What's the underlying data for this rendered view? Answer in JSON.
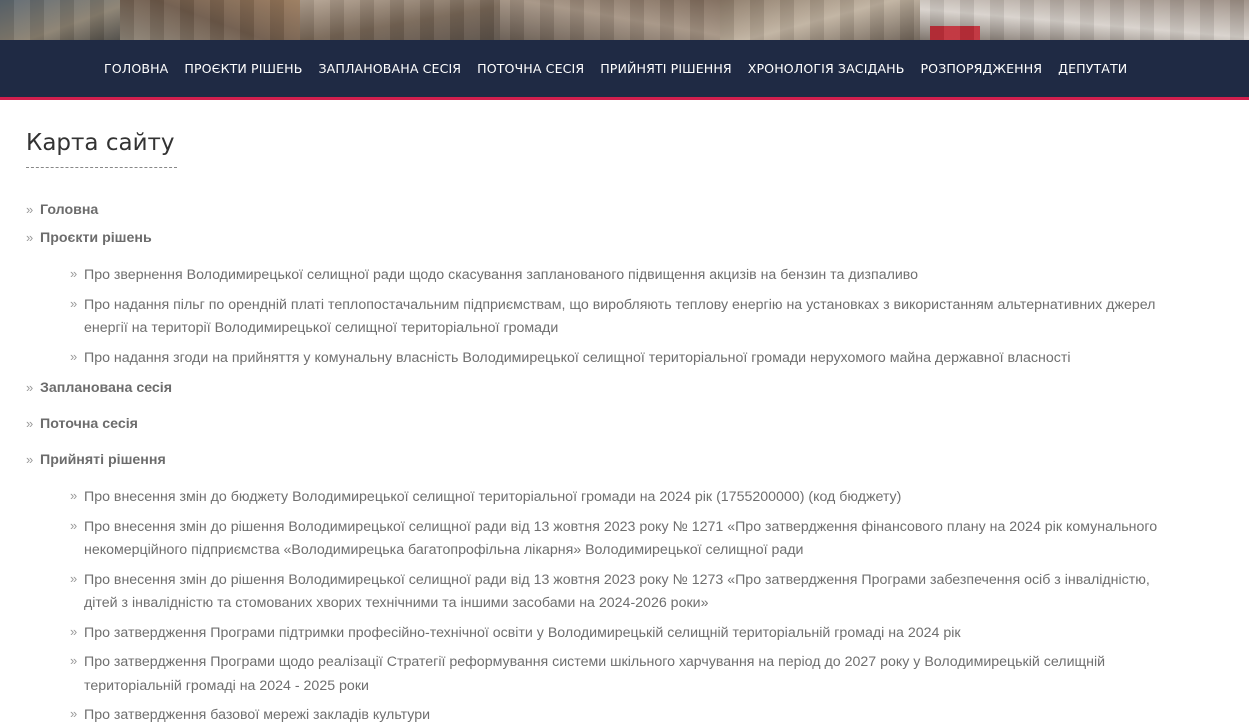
{
  "colors": {
    "nav_background": "#1f2a44",
    "nav_accent_line": "#d11f4e",
    "text": "#6f6f6f",
    "title": "#333333"
  },
  "nav": {
    "items": [
      {
        "label": "ГОЛОВНА"
      },
      {
        "label": "ПРОЄКТИ РІШЕНЬ"
      },
      {
        "label": "ЗАПЛАНОВАНА СЕСІЯ"
      },
      {
        "label": "ПОТОЧНА СЕСІЯ"
      },
      {
        "label": "ПРИЙНЯТІ РІШЕННЯ"
      },
      {
        "label": "ХРОНОЛОГІЯ ЗАСІДАНЬ"
      },
      {
        "label": "РОЗПОРЯДЖЕННЯ"
      },
      {
        "label": "ДЕПУТАТИ"
      }
    ]
  },
  "page": {
    "title": "Карта сайту"
  },
  "sitemap": {
    "sections": [
      {
        "label": "Головна",
        "children": []
      },
      {
        "label": "Проєкти рішень",
        "children": [
          {
            "label": "Про звернення Володимирецької селищної ради щодо скасування запланованого підвищення акцизів на бензин та дизпаливо"
          },
          {
            "label": "Про надання пільг по орендній платі теплопостачальним підприємствам, що виробляють теплову енергію на установках з використанням альтернативних джерел енергії на території Володимирецької селищної територіальної громади"
          },
          {
            "label": "Про надання згоди на  прийняття у комунальну власність Володимирецької селищної територіальної громади нерухомого майна державної власності"
          }
        ]
      },
      {
        "label": "Запланована сесія",
        "children": []
      },
      {
        "label": "Поточна сесія",
        "children": []
      },
      {
        "label": "Прийняті рішення",
        "children": [
          {
            "label": "Про внесення змін до бюджету Володимирецької селищної територіальної громади на 2024 рік (1755200000) (код бюджету)"
          },
          {
            "label": "Про внесення змін до рішення Володимирецької селищної ради від 13 жовтня 2023 року № 1271 «Про затвердження фінансового плану на 2024 рік комунального некомерційного підприємства «Володимирецька багатопрофільна лікарня» Володимирецької селищної ради"
          },
          {
            "label": "Про внесення змін до рішення Володимирецької селищної ради від 13 жовтня 2023 року № 1273 «Про затвердження Програми забезпечення осіб з інвалідністю, дітей з інвалідністю та стомованих хворих технічними та іншими засобами на 2024-2026 роки»"
          },
          {
            "label": "Про затвердження Програми підтримки професійно-технічної освіти у Володимирецькій селищній територіальній громаді на 2024 рік"
          },
          {
            "label": "Про затвердження Програми щодо реалізації Стратегії реформування системи шкільного харчування на період до 2027 року у Володимирецькій селищній територіальній громаді на 2024 - 2025 роки"
          },
          {
            "label": "Про затвердження базової мережі закладів культури"
          }
        ]
      }
    ]
  }
}
